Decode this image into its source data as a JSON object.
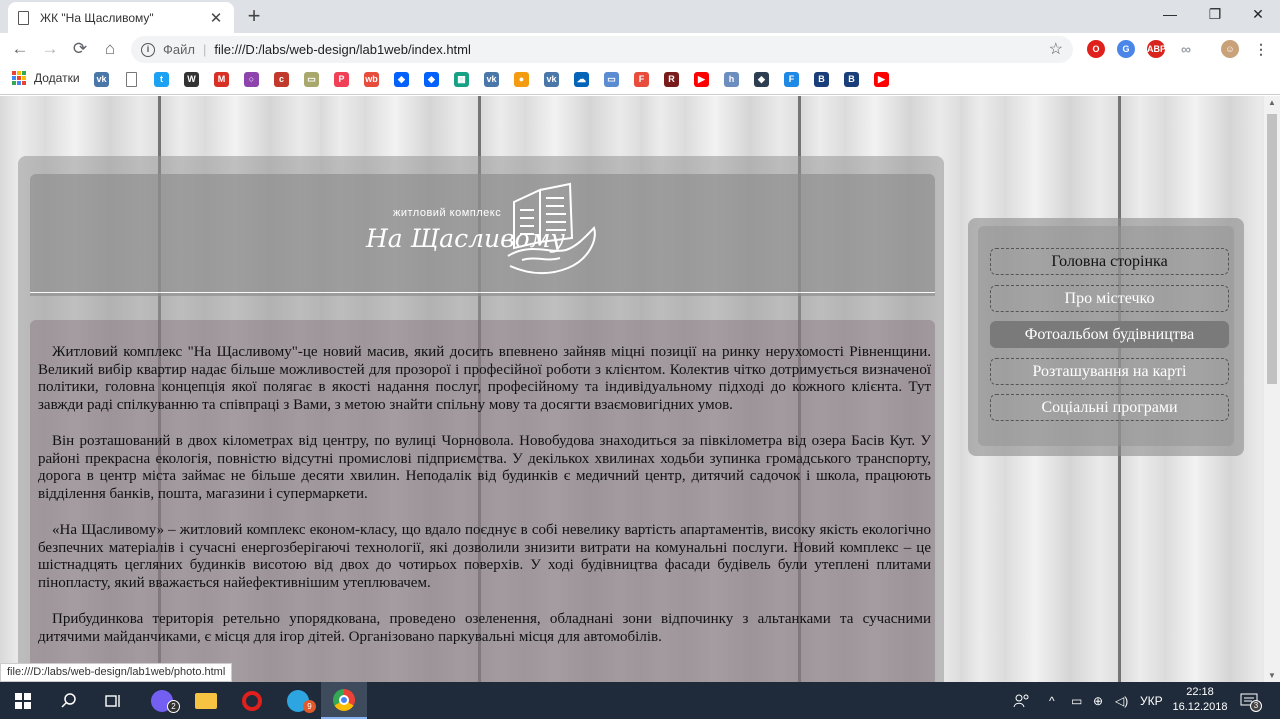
{
  "browser": {
    "tab_title": "ЖК \"На Щасливому\"",
    "tab_close": "✕",
    "new_tab": "+",
    "window_controls": [
      "—",
      "❐",
      "✕"
    ],
    "nav": {
      "back": "←",
      "forward": "→",
      "reload": "⟳",
      "home": "⌂"
    },
    "address": {
      "info": "i",
      "scheme": "Файл",
      "separator": "|",
      "url": "file:///D:/labs/web-design/lab1web/index.html",
      "star": "☆"
    },
    "extensions": [
      {
        "name": "opera-icon",
        "label": "O",
        "color": "#e0201d"
      },
      {
        "name": "translate-icon",
        "label": "G",
        "color": "#4a86e8"
      },
      {
        "name": "adblock-icon",
        "label": "ABP",
        "color": "#d8241c"
      },
      {
        "name": "infinity-icon",
        "label": "∞",
        "color": "#9aa0a6"
      },
      {
        "name": "profile-avatar-icon",
        "label": "☺",
        "color": "#c9a27a"
      },
      {
        "name": "menu-icon",
        "label": "⋮",
        "color": "#5f6368"
      }
    ]
  },
  "bookmarks": {
    "apps_label": "Додатки",
    "items": [
      {
        "name": "vk-icon",
        "label": "vk",
        "color": "#4a76a8"
      },
      {
        "name": "page-icon",
        "label": "",
        "color": "#ffffff"
      },
      {
        "name": "twitter-icon",
        "label": "t",
        "color": "#1da1f2"
      },
      {
        "name": "wikipedia-icon",
        "label": "W",
        "color": "#333333"
      },
      {
        "name": "gmail-icon",
        "label": "M",
        "color": "#d93025"
      },
      {
        "name": "circle-icon",
        "label": "○",
        "color": "#8e44ad"
      },
      {
        "name": "curl-icon",
        "label": "c",
        "color": "#c0392b"
      },
      {
        "name": "image-icon",
        "label": "▭",
        "color": "#a8a86c"
      },
      {
        "name": "pocket-icon",
        "label": "P",
        "color": "#ef4056"
      },
      {
        "name": "web-icon",
        "label": "wb",
        "color": "#e74c3c"
      },
      {
        "name": "dropbox-icon",
        "label": "◆",
        "color": "#0061ff"
      },
      {
        "name": "dropbox-2-icon",
        "label": "◆",
        "color": "#0061ff"
      },
      {
        "name": "grid-icon",
        "label": "▦",
        "color": "#16a085"
      },
      {
        "name": "vk-2-icon",
        "label": "vk",
        "color": "#4a76a8"
      },
      {
        "name": "orange-circle-icon",
        "label": "●",
        "color": "#f39c12"
      },
      {
        "name": "vk-3-icon",
        "label": "vk",
        "color": "#4a76a8"
      },
      {
        "name": "onedrive-icon",
        "label": "☁",
        "color": "#0364b8"
      },
      {
        "name": "slides-icon",
        "label": "▭",
        "color": "#5b8bd0"
      },
      {
        "name": "f-icon",
        "label": "F",
        "color": "#e74c3c"
      },
      {
        "name": "r-icon",
        "label": "R",
        "color": "#7a1b1b"
      },
      {
        "name": "youtube-icon",
        "label": "▶",
        "color": "#ff0000"
      },
      {
        "name": "h-icon",
        "label": "h",
        "color": "#6c8ebf"
      },
      {
        "name": "drop-icon",
        "label": "◆",
        "color": "#2c3e50"
      },
      {
        "name": "f-blue-icon",
        "label": "F",
        "color": "#1e88e5"
      },
      {
        "name": "b-icon",
        "label": "B",
        "color": "#1a3e7a"
      },
      {
        "name": "b-2-icon",
        "label": "B",
        "color": "#1a3e7a"
      },
      {
        "name": "youtube-2-icon",
        "label": "▶",
        "color": "#ff0000"
      }
    ]
  },
  "site": {
    "logo_top": "житловий комплекс",
    "logo_main": "На Щасливому",
    "menu": [
      "Головна сторінка",
      "Про містечко",
      "Фотоальбом будівництва",
      "Розташування на карті",
      "Соціальні програми"
    ],
    "paragraphs": [
      "Житловий комплекс \"На Щасливому\"-це новий масив, який досить впевнено зайняв міцні позиції на ринку нерухомості Рівненщини. Великий вибір квартир надає більше можливостей для прозорої і професійної роботи з клієнтом. Колектив чітко дотримується визначеної політики, головна концепція якої полягає в якості надання послуг, професійному та індивідуальному підході до кожного клієнта. Тут завжди раді спілкуванню та співпраці з Вами, з метою знайти спільну мову та досягти взаємовигідних умов.",
      "Він розташований в двох кілометрах від центру, по вулиці Чорновола. Новобудова знаходиться за півкілометра від озера Басів Кут. У районі прекрасна екологія, повністю відсутні промислові підприємства. У декількох хвилинах ходьби зупинка громадського транспорту, дорога в центр міста займає не більше десяти хвилин. Неподалік від будинків є медичний центр, дитячий садочок і школа, працюють відділення банків, пошта, магазини і супермаркети.",
      "«На Щасливому» – житловий комплекс економ-класу, що вдало поєднує в собі невелику вартість апартаментів, високу якість екологічно безпечних матеріалів і сучасні енергозберігаючі технології, які дозволили знизити витрати на комунальні послуги. Новий комплекс – це шістнадцять цегляних будинків висотою від двох до чотирьох поверхів. У ході будівництва фасади будівель були утеплені плитами пінопласту, який вважається найефективнішим утеплювачем.",
      "Прибудинкова територія ретельно упорядкована, проведено озеленення, обладнані зони відпочинку з альтанками та сучасними дитячими майданчиками, є місця для ігор дітей. Організовано паркувальні місця для автомобілів."
    ]
  },
  "status_url": "file:///D:/labs/web-design/lab1web/photo.html",
  "taskbar": {
    "viber_badge": "2",
    "telegram_badge": "9",
    "lang": "УКР",
    "time": "22:18",
    "date": "16.12.2018",
    "notif_badge": "3"
  }
}
